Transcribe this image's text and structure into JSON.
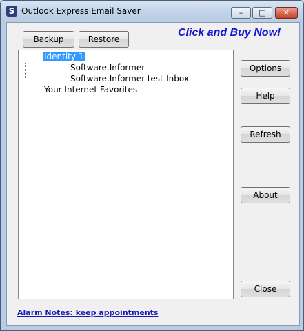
{
  "window": {
    "title": "Outlook Express Email Saver",
    "app_icon_glyph": "S",
    "controls": {
      "minimize": "–",
      "maximize": "□",
      "close": "✕"
    }
  },
  "toolbar": {
    "backup_label": "Backup",
    "restore_label": "Restore"
  },
  "promo": {
    "link_text": "Click and Buy Now!"
  },
  "tree": {
    "root": "Identity 1",
    "children": [
      "Software.Informer",
      "Software.Informer-test-Inbox"
    ],
    "extra": "Your Internet Favorites"
  },
  "side_buttons": {
    "options": "Options",
    "help": "Help",
    "refresh": "Refresh",
    "about": "About",
    "close": "Close"
  },
  "footer": {
    "link_text": "Alarm Notes: keep appointments"
  },
  "colors": {
    "link": "#1414d4",
    "selection": "#3399ff"
  }
}
